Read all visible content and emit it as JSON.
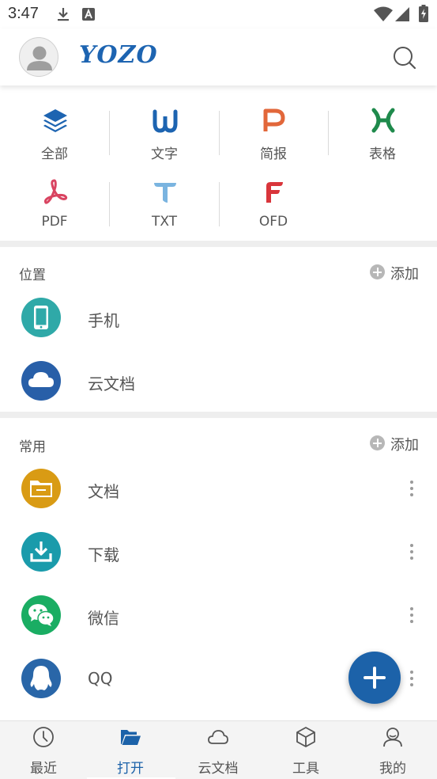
{
  "status_bar": {
    "time": "3:47"
  },
  "header": {
    "logo_text": "YOZO"
  },
  "file_types": [
    {
      "label": "全部",
      "icon": "layers-icon",
      "color": "#1d64b1"
    },
    {
      "label": "文字",
      "icon": "w-letter-icon",
      "color": "#1d64b1"
    },
    {
      "label": "简报",
      "icon": "p-letter-icon",
      "color": "#e2673a"
    },
    {
      "label": "表格",
      "icon": "x-letter-icon",
      "color": "#1f8a4c"
    },
    {
      "label": "PDF",
      "icon": "pdf-icon",
      "color": "#d94461"
    },
    {
      "label": "TXT",
      "icon": "t-letter-icon",
      "color": "#7ab4e0"
    },
    {
      "label": "OFD",
      "icon": "f-letter-icon",
      "color": "#d9353b"
    }
  ],
  "locations": {
    "title": "位置",
    "add_label": "添加",
    "items": [
      {
        "label": "手机",
        "icon": "phone-icon",
        "color": "#2fa9a8"
      },
      {
        "label": "云文档",
        "icon": "cloud-icon",
        "color": "#285fa8"
      }
    ]
  },
  "favorites": {
    "title": "常用",
    "add_label": "添加",
    "items": [
      {
        "label": "文档",
        "icon": "folder-icon",
        "color": "#d99b14"
      },
      {
        "label": "下载",
        "icon": "download-icon",
        "color": "#1a9bab"
      },
      {
        "label": "微信",
        "icon": "wechat-icon",
        "color": "#1aad63"
      },
      {
        "label": "QQ",
        "icon": "qq-icon",
        "color": "#2966a8"
      }
    ]
  },
  "bottom_nav": [
    {
      "label": "最近",
      "icon": "clock-icon",
      "active": false
    },
    {
      "label": "打开",
      "icon": "open-folder-icon",
      "active": true
    },
    {
      "label": "云文档",
      "icon": "cloud-outline-icon",
      "active": false
    },
    {
      "label": "工具",
      "icon": "box-icon",
      "active": false
    },
    {
      "label": "我的",
      "icon": "person-icon",
      "active": false
    }
  ],
  "colors": {
    "accent": "#1c62a9",
    "divider_band": "#eeeeee"
  }
}
